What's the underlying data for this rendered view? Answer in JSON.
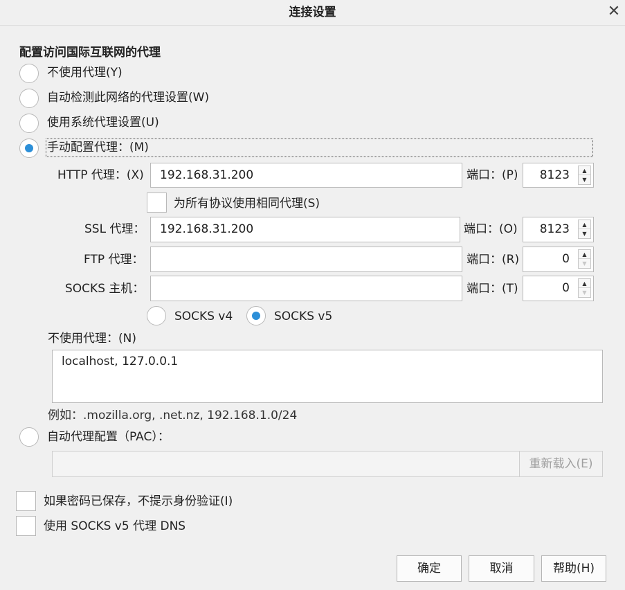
{
  "window": {
    "title": "连接设置"
  },
  "section_title": "配置访问国际互联网的代理",
  "proxy_modes": [
    {
      "label": "不使用代理(Y)",
      "selected": false
    },
    {
      "label": "自动检测此网络的代理设置(W)",
      "selected": false
    },
    {
      "label": "使用系统代理设置(U)",
      "selected": false
    },
    {
      "label": "手动配置代理：(M)",
      "selected": true
    }
  ],
  "manual": {
    "http": {
      "label": "HTTP 代理：(X)",
      "value": "192.168.31.200",
      "port_label": "端口：(P)",
      "port": "8123"
    },
    "same_for_all": {
      "label": "为所有协议使用相同代理(S)",
      "checked": false
    },
    "ssl": {
      "label": "SSL 代理：",
      "value": "192.168.31.200",
      "port_label": "端口：(O)",
      "port": "8123"
    },
    "ftp": {
      "label": "FTP 代理：",
      "value": "",
      "port_label": "端口：(R)",
      "port": "0"
    },
    "socks": {
      "label": "SOCKS 主机：",
      "value": "",
      "port_label": "端口：(T)",
      "port": "0"
    },
    "socks_versions": [
      {
        "label": "SOCKS v4",
        "selected": false
      },
      {
        "label": "SOCKS v5",
        "selected": true
      }
    ]
  },
  "no_proxy": {
    "label": "不使用代理：(N)",
    "value": "localhost, 127.0.0.1",
    "example": "例如：.mozilla.org, .net.nz, 192.168.1.0/24"
  },
  "pac": {
    "label": "自动代理配置（PAC）：",
    "selected": false,
    "value": "",
    "reload_label": "重新载入(E)"
  },
  "options": [
    {
      "label": "如果密码已保存，不提示身份验证(I)",
      "checked": false
    },
    {
      "label": "使用 SOCKS v5 代理 DNS",
      "checked": false
    }
  ],
  "buttons": {
    "ok": "确定",
    "cancel": "取消",
    "help": "帮助(H)"
  },
  "colors": {
    "accent": "#2c8fd8",
    "background": "#f0f0f0"
  }
}
